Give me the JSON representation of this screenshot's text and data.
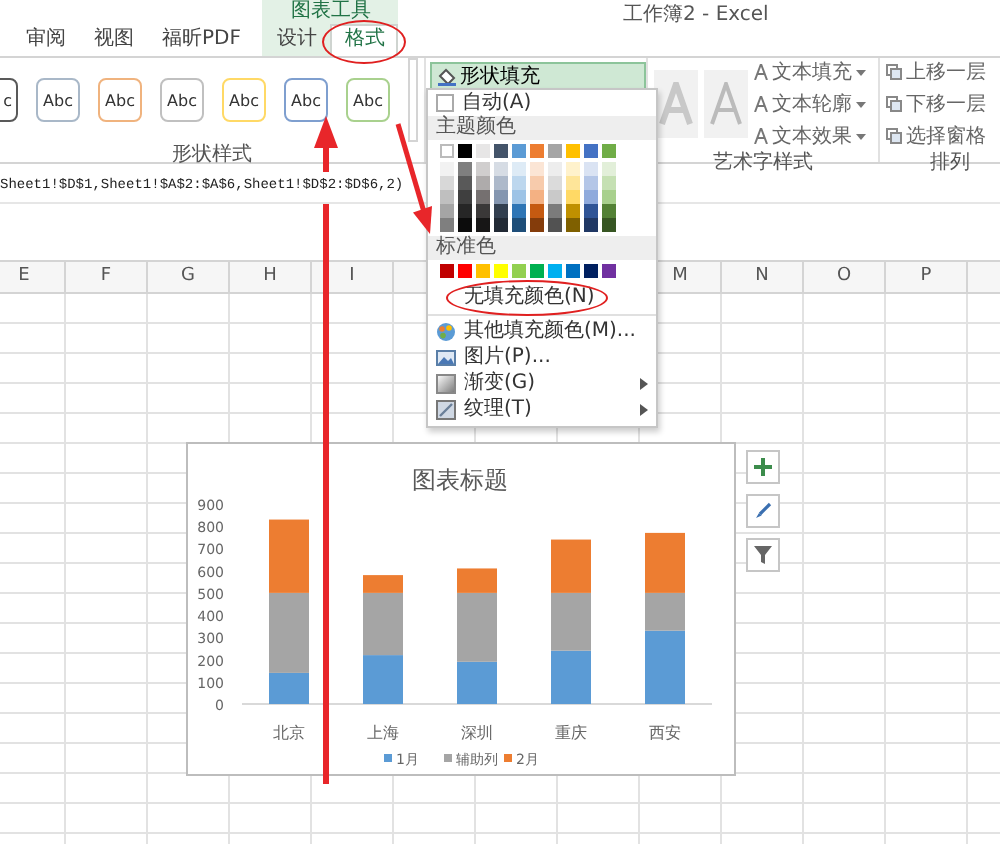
{
  "window": {
    "title": "工作簿2 - Excel"
  },
  "tabs": [
    {
      "label": "审阅",
      "selected": false
    },
    {
      "label": "视图",
      "selected": false
    },
    {
      "label": "福昕PDF",
      "selected": false
    }
  ],
  "context_tabs": {
    "label": "图表工具",
    "tabs": [
      {
        "label": "设计",
        "selected": false
      },
      {
        "label": "格式",
        "selected": true,
        "circled": true
      }
    ]
  },
  "ribbon": {
    "shape_styles": {
      "label": "形状样式",
      "items": [
        {
          "label": "c",
          "color": "#595959"
        },
        {
          "label": "Abc",
          "color": "#a9b8c8"
        },
        {
          "label": "Abc",
          "color": "#f0b37e"
        },
        {
          "label": "Abc",
          "color": "#c0c0c0"
        },
        {
          "label": "Abc",
          "color": "#ffd966"
        },
        {
          "label": "Abc",
          "color": "#7f9fcf"
        },
        {
          "label": "Abc",
          "color": "#a9d18e"
        }
      ]
    },
    "shape_fill_button": "形状填充",
    "wordart": {
      "label": "艺术字样式",
      "buttons": [
        "文本填充",
        "文本轮廓",
        "文本效果"
      ]
    },
    "arrange": {
      "label": "排列",
      "buttons": [
        "上移一层",
        "下移一层",
        "选择窗格"
      ]
    }
  },
  "formula_bar": "Sheet1!$D$1,Sheet1!$A$2:$A$6,Sheet1!$D$2:$D$6,2)",
  "column_headers": [
    "E",
    "F",
    "G",
    "H",
    "I",
    "M",
    "N",
    "O",
    "P"
  ],
  "fill_menu": {
    "auto": "自动(A)",
    "theme_label": "主题颜色",
    "theme_colors": [
      [
        {
          "color": "#ffffff"
        },
        {
          "color": "#000000"
        },
        {
          "color": "#e7e6e6"
        },
        {
          "color": "#44546a"
        },
        {
          "color": "#5b9bd5"
        },
        {
          "color": "#ed7d31"
        },
        {
          "color": "#a5a5a5"
        },
        {
          "color": "#ffc000"
        },
        {
          "color": "#4472c4"
        },
        {
          "color": "#70ad47"
        }
      ],
      [
        {
          "color": "#f2f2f2"
        },
        {
          "color": "#7f7f7f"
        },
        {
          "color": "#d0cece"
        },
        {
          "color": "#d6dce4"
        },
        {
          "color": "#deebf6"
        },
        {
          "color": "#fbe5d5"
        },
        {
          "color": "#ededed"
        },
        {
          "color": "#fff2cc"
        },
        {
          "color": "#dae3f3"
        },
        {
          "color": "#e2efd9"
        }
      ],
      [
        {
          "color": "#d8d8d8"
        },
        {
          "color": "#595959"
        },
        {
          "color": "#aeabab"
        },
        {
          "color": "#adb9ca"
        },
        {
          "color": "#bdd7ee"
        },
        {
          "color": "#f7cbac"
        },
        {
          "color": "#dbdbdb"
        },
        {
          "color": "#fee599"
        },
        {
          "color": "#b4c6e7"
        },
        {
          "color": "#c5e0b3"
        }
      ],
      [
        {
          "color": "#bfbfbf"
        },
        {
          "color": "#3f3f3f"
        },
        {
          "color": "#757070"
        },
        {
          "color": "#8496b0"
        },
        {
          "color": "#9dc3e6"
        },
        {
          "color": "#f4b183"
        },
        {
          "color": "#c9c9c9"
        },
        {
          "color": "#ffd965"
        },
        {
          "color": "#8faadc"
        },
        {
          "color": "#a8d08d"
        }
      ],
      [
        {
          "color": "#a5a5a5"
        },
        {
          "color": "#262626"
        },
        {
          "color": "#3a3838"
        },
        {
          "color": "#323f4f"
        },
        {
          "color": "#2e75b5"
        },
        {
          "color": "#c55a11"
        },
        {
          "color": "#7b7b7b"
        },
        {
          "color": "#bf9000"
        },
        {
          "color": "#2f5496"
        },
        {
          "color": "#538135"
        }
      ],
      [
        {
          "color": "#7f7f7f"
        },
        {
          "color": "#0c0c0c"
        },
        {
          "color": "#171616"
        },
        {
          "color": "#222a35"
        },
        {
          "color": "#1e4e79"
        },
        {
          "color": "#843c0b"
        },
        {
          "color": "#525252"
        },
        {
          "color": "#7f6000"
        },
        {
          "color": "#203864"
        },
        {
          "color": "#375623"
        }
      ]
    ],
    "standard_label": "标准色",
    "standard_colors": [
      {
        "color": "#c00000"
      },
      {
        "color": "#ff0000"
      },
      {
        "color": "#ffc000"
      },
      {
        "color": "#ffff00"
      },
      {
        "color": "#92d050"
      },
      {
        "color": "#00b050"
      },
      {
        "color": "#00b0f0"
      },
      {
        "color": "#0070c0"
      },
      {
        "color": "#002060"
      },
      {
        "color": "#7030a0"
      }
    ],
    "no_fill": {
      "label": "无填充颜色(N)",
      "circled": true
    },
    "items": [
      {
        "kind": "palette",
        "label": "其他填充颜色(M)...",
        "submenu": false
      },
      {
        "kind": "picture",
        "label": "图片(P)...",
        "submenu": false
      },
      {
        "kind": "gradient",
        "label": "渐变(G)",
        "submenu": true
      },
      {
        "kind": "texture",
        "label": "纹理(T)",
        "submenu": true
      }
    ]
  },
  "chart": {
    "chart_data": {
      "type": "bar",
      "title": "图表标题",
      "categories": [
        "北京",
        "上海",
        "深圳",
        "重庆",
        "西安"
      ],
      "stacked": true,
      "legend": "bottom",
      "ylim": [
        0,
        900
      ],
      "yticks": [
        0,
        100,
        200,
        300,
        400,
        500,
        600,
        700,
        800,
        900
      ],
      "series": [
        {
          "name": "1月",
          "color": "#5b9bd5",
          "values": [
            140,
            220,
            190,
            240,
            330
          ]
        },
        {
          "name": "辅助列",
          "color": "#a5a5a5",
          "values": [
            360,
            280,
            310,
            260,
            170
          ]
        },
        {
          "name": "2月",
          "color": "#ed7d31",
          "values": [
            330,
            80,
            110,
            240,
            270
          ]
        }
      ]
    }
  }
}
